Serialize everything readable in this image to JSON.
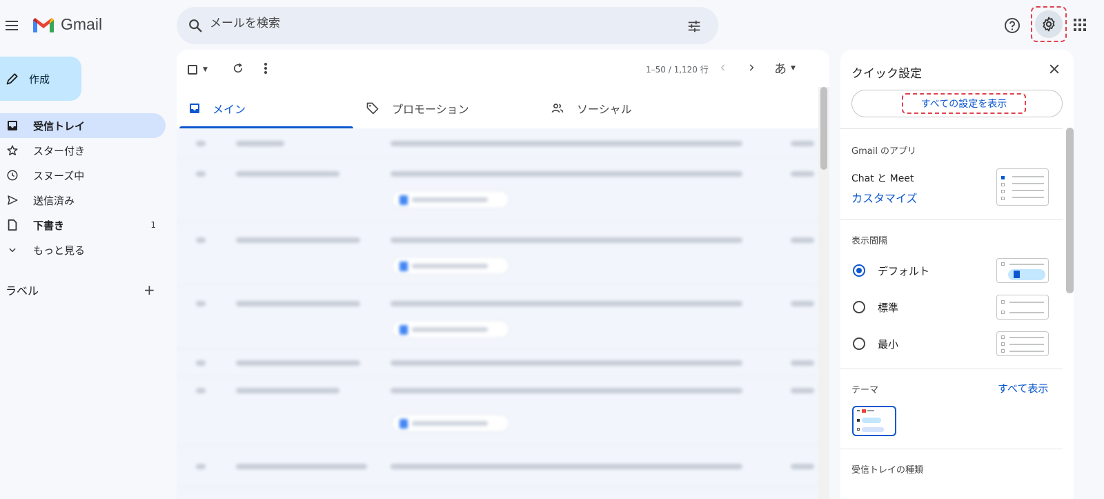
{
  "header": {
    "app_name": "Gmail",
    "search_placeholder": "メールを検索"
  },
  "sidebar": {
    "compose_label": "作成",
    "items": [
      {
        "label": "受信トレイ",
        "icon": "inbox-icon"
      },
      {
        "label": "スター付き",
        "icon": "star-icon"
      },
      {
        "label": "スヌーズ中",
        "icon": "clock-icon"
      },
      {
        "label": "送信済み",
        "icon": "send-icon"
      },
      {
        "label": "下書き",
        "icon": "draft-icon",
        "count": "1"
      },
      {
        "label": "もっと見る",
        "icon": "chevron-down-icon"
      }
    ],
    "labels_title": "ラベル",
    "labels_add": "+"
  },
  "toolbar": {
    "paging": "1–50 / 1,120 行",
    "input_mode": "あ"
  },
  "tabs": [
    {
      "label": "メイン",
      "icon": "inbox-icon",
      "active": true
    },
    {
      "label": "プロモーション",
      "icon": "tag-icon",
      "active": false
    },
    {
      "label": "ソーシャル",
      "icon": "people-icon",
      "active": false
    }
  ],
  "quick_settings": {
    "title": "クイック設定",
    "all_settings_button": "すべての設定を表示",
    "apps_section": "Gmail のアプリ",
    "apps_label": "Chat と Meet",
    "apps_customize": "カスタマイズ",
    "density_section": "表示間隔",
    "density_options": [
      "デフォルト",
      "標準",
      "最小"
    ],
    "density_selected": "デフォルト",
    "theme_section": "テーマ",
    "theme_view_all": "すべて表示",
    "inbox_type_section": "受信トレイの種類"
  },
  "colors": {
    "accent": "#0b57d0",
    "compose_bg": "#c2e7ff",
    "active_nav_bg": "#d3e3fd",
    "highlight": "#e0414c"
  }
}
